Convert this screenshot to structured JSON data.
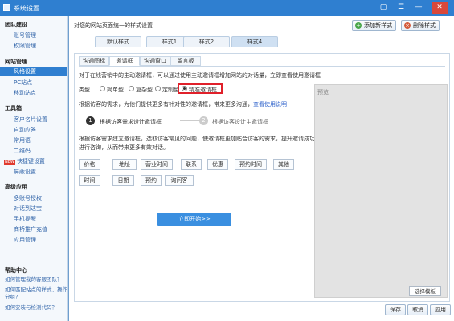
{
  "window": {
    "title": "系统设置",
    "btn_skin": "▢",
    "btn_menu": "☰",
    "btn_min": "—",
    "btn_close": "✕"
  },
  "sidebar": {
    "groups": [
      {
        "label": "团队建设",
        "items": [
          "账号管理",
          "权限管理"
        ]
      },
      {
        "label": "网站管理",
        "items": [
          "风格设置",
          "PC站点",
          "移动站点"
        ]
      },
      {
        "label": "工具箱",
        "items": [
          "客户名片设置",
          "自动应答",
          "常用语",
          "二维码",
          "快捷键设置",
          "屏蔽设置"
        ]
      },
      {
        "label": "高级应用",
        "items": [
          "多账号授权",
          "对话到达宝",
          "手机提醒",
          "商桥推广充值",
          "应用管理"
        ]
      }
    ],
    "active_item": "风格设置",
    "new_badge": "NEW",
    "help": {
      "title": "帮助中心",
      "links": [
        "如何管理我的客服团队？",
        "如何匹配站点的样式、操作分组？",
        "如何安装与检测代码？"
      ]
    }
  },
  "header": {
    "description": "对您的网站页面统一的样式设置",
    "add_style_label": "添加新样式",
    "delete_style_label": "删除样式",
    "add_icon_glyph": "+",
    "delete_icon_glyph": "×"
  },
  "style_tabs": [
    "默认样式",
    "样式1",
    "样式2",
    "样式4"
  ],
  "active_style_tab": 3,
  "sub_tabs": [
    "沟通图标",
    "邀请框",
    "沟通窗口",
    "留言板"
  ],
  "active_sub_tab": 1,
  "invite": {
    "intro_text": "对于在线营销中的主动邀请框，可以通过使用主动邀请框增加网站的对话量，立即查看使用邀请框",
    "intro_link": "立即查看使用邀请框",
    "type_label": "类型",
    "types": [
      "简单型",
      "复杂型",
      "定制型",
      "精准邀请框"
    ],
    "selected_type": 3,
    "subtitle_text": "根据访客的需求，为他们提供更多有针对性的邀请框，带来更多沟通，",
    "subtitle_link": "查看使用说明",
    "steps": [
      {
        "num": "1",
        "label": "根据访客需求设计邀请框"
      },
      {
        "num": "2",
        "label": "根据访客设计主邀请框"
      }
    ],
    "desc_line1": "根据访客需求建立邀请框，选取访客常见的问题，使邀请框更加贴合访客的需求，提升邀请成功率，引导访客",
    "desc_line2": "进行咨询，从而带来更多有效对话。",
    "keywords_row1": [
      "价格",
      "地址",
      "营业时间",
      "联系",
      "优惠",
      "预约时间",
      "其他"
    ],
    "keywords_row2": [
      "时间",
      "日期",
      "预约",
      "询问客"
    ],
    "start_button": "立即开始>>",
    "preview_label": "预览",
    "pick_button": "选择模板"
  },
  "footer": {
    "save": "保存",
    "cancel": "取消",
    "apply": "应用"
  },
  "colors": {
    "titlebar": "#2f7fd0",
    "active_item": "#2f7fd0",
    "start_button": "#3a8fe0",
    "highlight": "#e0202a"
  }
}
